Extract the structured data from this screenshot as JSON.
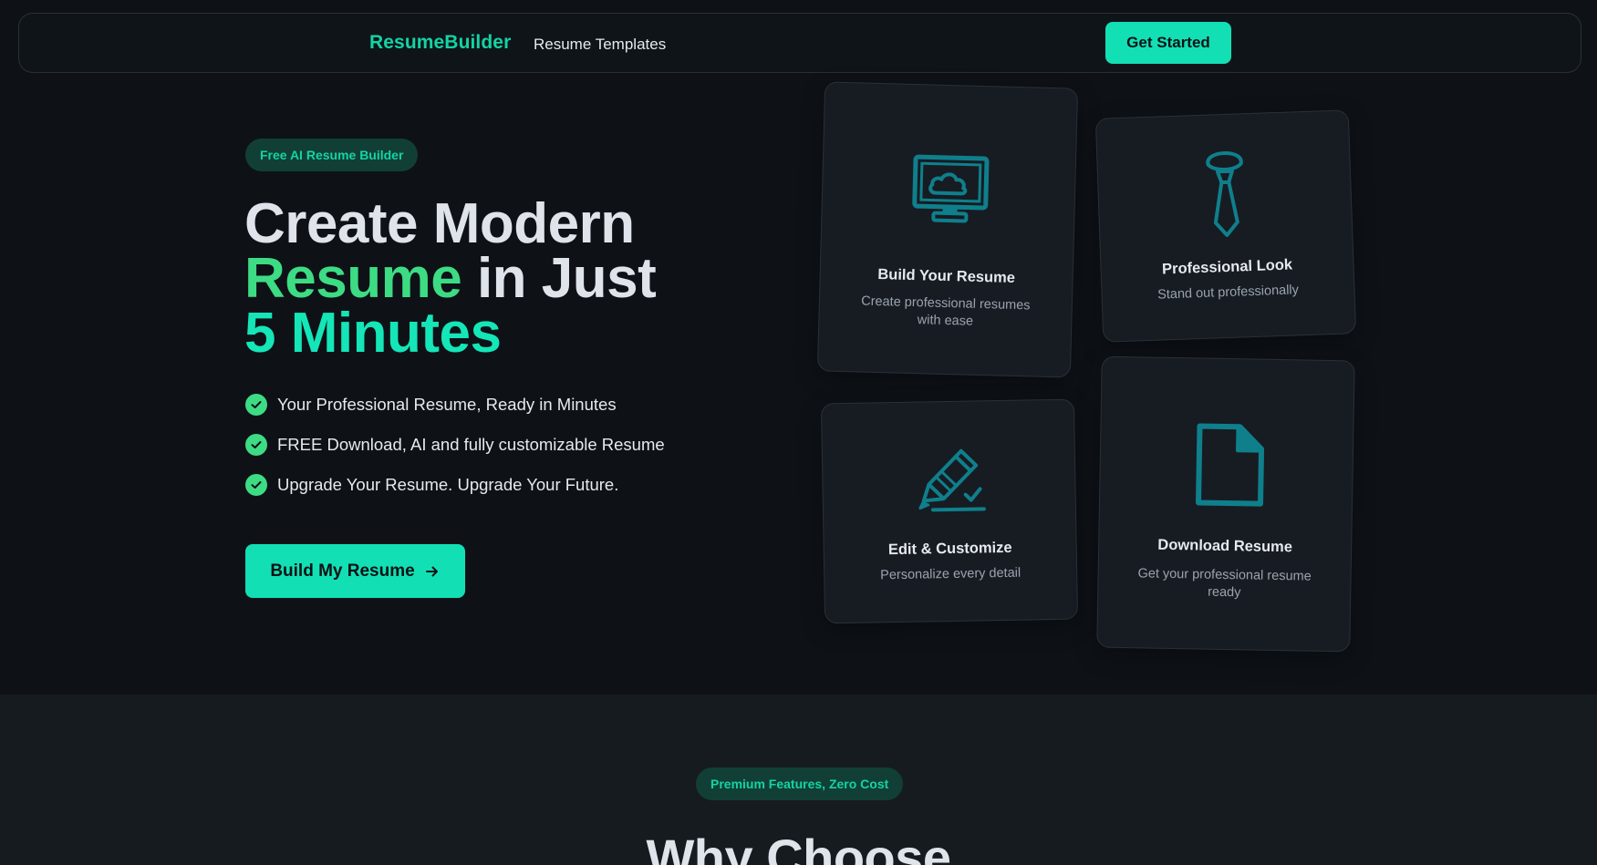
{
  "nav": {
    "brand": "ResumeBuilder",
    "links": [
      {
        "label": "Resume Templates"
      }
    ],
    "cta_label": "Get Started"
  },
  "hero": {
    "badge": "Free AI Resume Builder",
    "headline": {
      "line1": "Create Modern",
      "line2_highlight": "Resume",
      "line2_rest": " in Just",
      "line3": "5 Minutes"
    },
    "features": [
      {
        "text": "Your Professional Resume, Ready in Minutes"
      },
      {
        "text": "FREE Download, AI and fully customizable Resume"
      },
      {
        "text": "Upgrade Your Resume. Upgrade Your Future."
      }
    ],
    "cta_label": "Build My Resume"
  },
  "cards": [
    {
      "icon": "monitor-cloud-icon",
      "title": "Build Your Resume",
      "desc": "Create professional resumes with ease"
    },
    {
      "icon": "tie-icon",
      "title": "Professional Look",
      "desc": "Stand out professionally"
    },
    {
      "icon": "pencil-edit-icon",
      "title": "Edit & Customize",
      "desc": "Personalize every detail"
    },
    {
      "icon": "document-icon",
      "title": "Download Resume",
      "desc": "Get your professional resume ready"
    }
  ],
  "section2": {
    "badge": "Premium Features, Zero Cost",
    "title": "Why Choose"
  },
  "colors": {
    "accent": "#12e0b4",
    "brand": "#14d3a3",
    "green": "#3ddc84",
    "icon": "#0f7f8c",
    "background": "#0e1217",
    "card": "#171c22"
  }
}
